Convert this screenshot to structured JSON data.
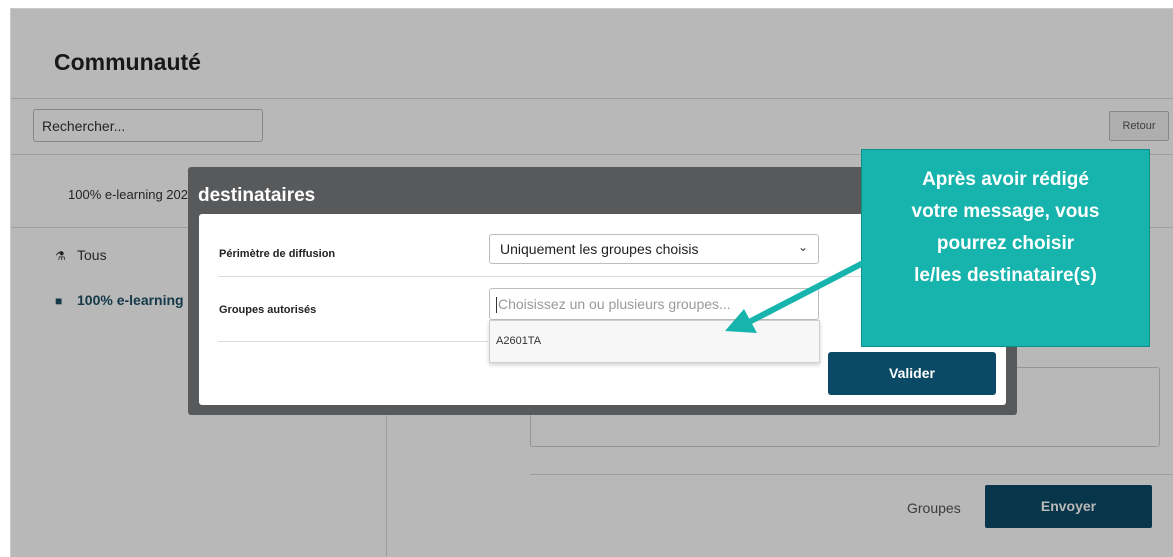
{
  "page": {
    "title": "Communauté",
    "search_placeholder": "Rechercher...",
    "back_label": "Retour",
    "course_tab": "100% e-learning 202",
    "sidebar": [
      {
        "label": "Tous",
        "icon": "sitemap-icon"
      },
      {
        "label": "100% e-learning",
        "icon": "folder-icon"
      }
    ],
    "groups_label": "Groupes",
    "send_label": "Envoyer"
  },
  "modal": {
    "title": "destinataires",
    "perimeter_label": "Périmètre de diffusion",
    "perimeter_value": "Uniquement les groupes choisis",
    "groups_label": "Groupes autorisés",
    "groups_placeholder": "Choisissez un ou plusieurs groupes...",
    "group_options": [
      "A2601TA"
    ],
    "validate_label": "Valider"
  },
  "callout": {
    "lines": [
      "Après avoir rédigé",
      "votre message, vous",
      "pourrez choisir",
      "le/les destinataire(s)"
    ]
  },
  "colors": {
    "accent": "#0b4a66",
    "callout_bg": "#16b4ad",
    "modal_header": "#58595b"
  }
}
